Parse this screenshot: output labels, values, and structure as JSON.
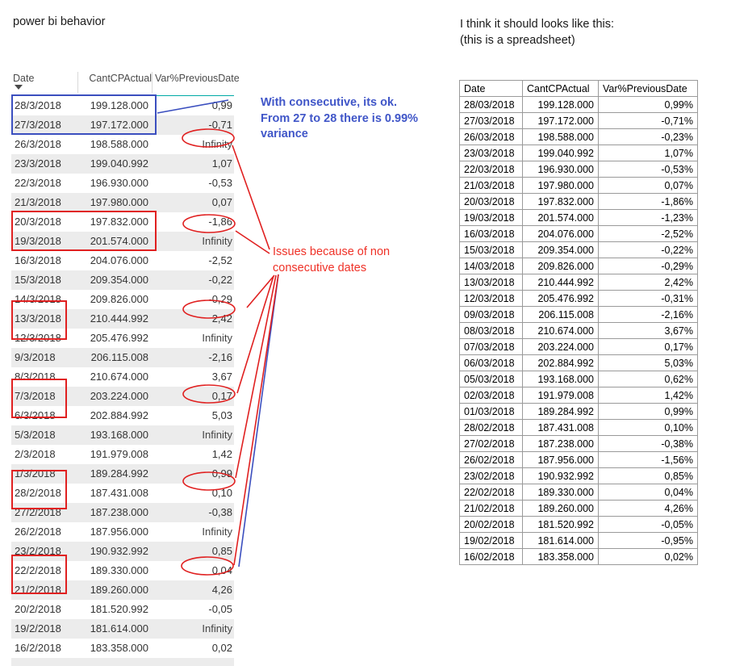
{
  "page_title": "power bi behavior",
  "spreadsheet_note": "I think it should looks like this:\n (this is a spreadsheet)",
  "annotations": {
    "consecutive": "With consecutive, its ok.\nFrom 27 to 28 there is 0.99%\nvariance",
    "issues": "Issues because of non\nconsecutive dates",
    "consecutive_color": "#4056c8",
    "issues_color": "#ef3127",
    "highlight_blue": "#3b4fbf",
    "highlight_red": "#e02020"
  },
  "powerbi_table": {
    "columns": [
      "Date",
      "CantCPActual",
      "Var%PreviousDate"
    ],
    "sort_indicator": "sort-descending-caret",
    "header_underline_color": "#00a9a5",
    "rows": [
      {
        "date": "28/3/2018",
        "value": "199.128.000",
        "var": "0,99"
      },
      {
        "date": "27/3/2018",
        "value": "197.172.000",
        "var": "-0,71"
      },
      {
        "date": "26/3/2018",
        "value": "198.588.000",
        "var": "Infinity"
      },
      {
        "date": "23/3/2018",
        "value": "199.040.992",
        "var": "1,07"
      },
      {
        "date": "22/3/2018",
        "value": "196.930.000",
        "var": "-0,53"
      },
      {
        "date": "21/3/2018",
        "value": "197.980.000",
        "var": "0,07"
      },
      {
        "date": "20/3/2018",
        "value": "197.832.000",
        "var": "-1,86"
      },
      {
        "date": "19/3/2018",
        "value": "201.574.000",
        "var": "Infinity"
      },
      {
        "date": "16/3/2018",
        "value": "204.076.000",
        "var": "-2,52"
      },
      {
        "date": "15/3/2018",
        "value": "209.354.000",
        "var": "-0,22"
      },
      {
        "date": "14/3/2018",
        "value": "209.826.000",
        "var": "-0,29"
      },
      {
        "date": "13/3/2018",
        "value": "210.444.992",
        "var": "2,42"
      },
      {
        "date": "12/3/2018",
        "value": "205.476.992",
        "var": "Infinity"
      },
      {
        "date": "9/3/2018",
        "value": "206.115.008",
        "var": "-2,16"
      },
      {
        "date": "8/3/2018",
        "value": "210.674.000",
        "var": "3,67"
      },
      {
        "date": "7/3/2018",
        "value": "203.224.000",
        "var": "0,17"
      },
      {
        "date": "6/3/2018",
        "value": "202.884.992",
        "var": "5,03"
      },
      {
        "date": "5/3/2018",
        "value": "193.168.000",
        "var": "Infinity"
      },
      {
        "date": "2/3/2018",
        "value": "191.979.008",
        "var": "1,42"
      },
      {
        "date": "1/3/2018",
        "value": "189.284.992",
        "var": "0,99"
      },
      {
        "date": "28/2/2018",
        "value": "187.431.008",
        "var": "0,10"
      },
      {
        "date": "27/2/2018",
        "value": "187.238.000",
        "var": "-0,38"
      },
      {
        "date": "26/2/2018",
        "value": "187.956.000",
        "var": "Infinity"
      },
      {
        "date": "23/2/2018",
        "value": "190.932.992",
        "var": "0,85"
      },
      {
        "date": "22/2/2018",
        "value": "189.330.000",
        "var": "0,04"
      },
      {
        "date": "21/2/2018",
        "value": "189.260.000",
        "var": "4,26"
      },
      {
        "date": "20/2/2018",
        "value": "181.520.992",
        "var": "-0,05"
      },
      {
        "date": "19/2/2018",
        "value": "181.614.000",
        "var": "Infinity"
      },
      {
        "date": "16/2/2018",
        "value": "183.358.000",
        "var": "0,02"
      }
    ]
  },
  "spreadsheet_table": {
    "columns": [
      "Date",
      "CantCPActual",
      "Var%PreviousDate"
    ],
    "rows": [
      {
        "date": "28/03/2018",
        "value": "199.128.000",
        "var": "0,99%"
      },
      {
        "date": "27/03/2018",
        "value": "197.172.000",
        "var": "-0,71%"
      },
      {
        "date": "26/03/2018",
        "value": "198.588.000",
        "var": "-0,23%"
      },
      {
        "date": "23/03/2018",
        "value": "199.040.992",
        "var": "1,07%"
      },
      {
        "date": "22/03/2018",
        "value": "196.930.000",
        "var": "-0,53%"
      },
      {
        "date": "21/03/2018",
        "value": "197.980.000",
        "var": "0,07%"
      },
      {
        "date": "20/03/2018",
        "value": "197.832.000",
        "var": "-1,86%"
      },
      {
        "date": "19/03/2018",
        "value": "201.574.000",
        "var": "-1,23%"
      },
      {
        "date": "16/03/2018",
        "value": "204.076.000",
        "var": "-2,52%"
      },
      {
        "date": "15/03/2018",
        "value": "209.354.000",
        "var": "-0,22%"
      },
      {
        "date": "14/03/2018",
        "value": "209.826.000",
        "var": "-0,29%"
      },
      {
        "date": "13/03/2018",
        "value": "210.444.992",
        "var": "2,42%"
      },
      {
        "date": "12/03/2018",
        "value": "205.476.992",
        "var": "-0,31%"
      },
      {
        "date": "09/03/2018",
        "value": "206.115.008",
        "var": "-2,16%"
      },
      {
        "date": "08/03/2018",
        "value": "210.674.000",
        "var": "3,67%"
      },
      {
        "date": "07/03/2018",
        "value": "203.224.000",
        "var": "0,17%"
      },
      {
        "date": "06/03/2018",
        "value": "202.884.992",
        "var": "5,03%"
      },
      {
        "date": "05/03/2018",
        "value": "193.168.000",
        "var": "0,62%"
      },
      {
        "date": "02/03/2018",
        "value": "191.979.008",
        "var": "1,42%"
      },
      {
        "date": "01/03/2018",
        "value": "189.284.992",
        "var": "0,99%"
      },
      {
        "date": "28/02/2018",
        "value": "187.431.008",
        "var": "0,10%"
      },
      {
        "date": "27/02/2018",
        "value": "187.238.000",
        "var": "-0,38%"
      },
      {
        "date": "26/02/2018",
        "value": "187.956.000",
        "var": "-1,56%"
      },
      {
        "date": "23/02/2018",
        "value": "190.932.992",
        "var": "0,85%"
      },
      {
        "date": "22/02/2018",
        "value": "189.330.000",
        "var": "0,04%"
      },
      {
        "date": "21/02/2018",
        "value": "189.260.000",
        "var": "4,26%"
      },
      {
        "date": "20/02/2018",
        "value": "181.520.992",
        "var": "-0,05%"
      },
      {
        "date": "19/02/2018",
        "value": "181.614.000",
        "var": "-0,95%"
      },
      {
        "date": "16/02/2018",
        "value": "183.358.000",
        "var": "0,02%"
      }
    ]
  }
}
